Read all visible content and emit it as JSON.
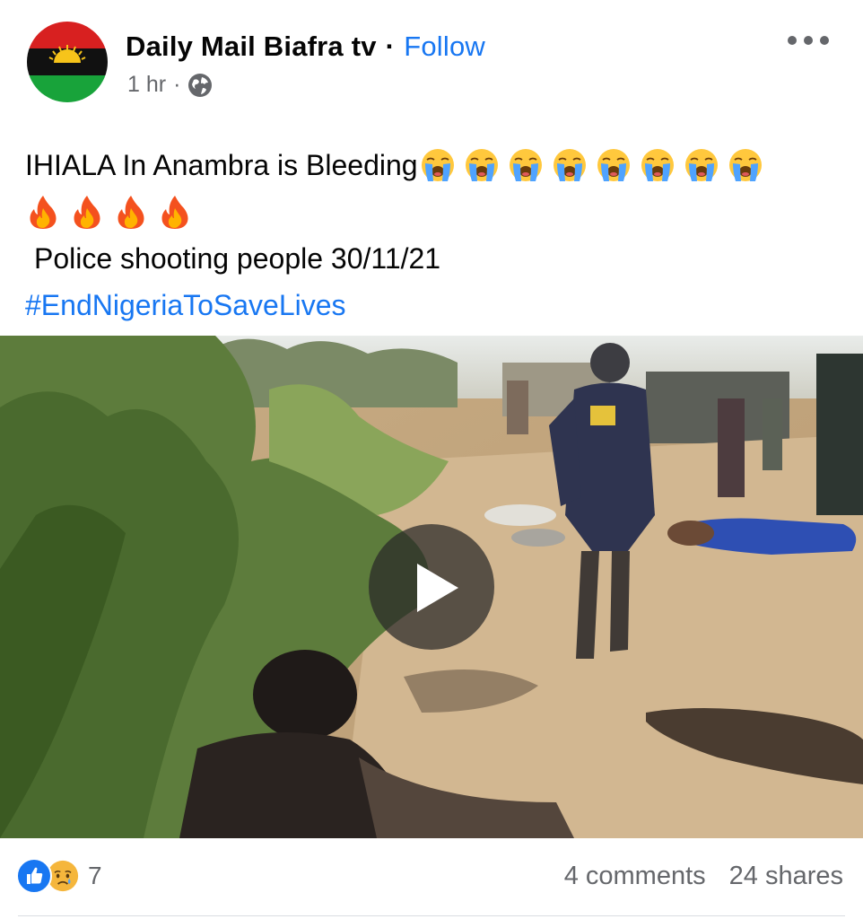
{
  "header": {
    "page_name": "Daily Mail Biafra tv",
    "separator": "·",
    "follow_label": "Follow",
    "time": "1 hr",
    "meta_separator": "·",
    "privacy_icon": "globe-icon",
    "more_icon": "more-options-icon"
  },
  "post": {
    "line1": "IHIALA In Anambra is Bleeding",
    "cry_emoji_icon": "loudly-crying-face-icon",
    "fire_emoji_icon": "fire-icon",
    "line3": "Police shooting people 30/11/21",
    "hashtag": "#EndNigeriaToSaveLives"
  },
  "video": {
    "play_icon": "play-icon"
  },
  "footer": {
    "like_icon": "like-reaction-icon",
    "sad_icon": "sad-reaction-icon",
    "reaction_count": "7",
    "comments": "4 comments",
    "shares": "24 shares"
  },
  "colors": {
    "link": "#1877f2",
    "secondary_text": "#65676b",
    "biafra_red": "#d82020",
    "biafra_black": "#111111",
    "biafra_green": "#18a33a",
    "biafra_sun": "#f7c41a"
  }
}
